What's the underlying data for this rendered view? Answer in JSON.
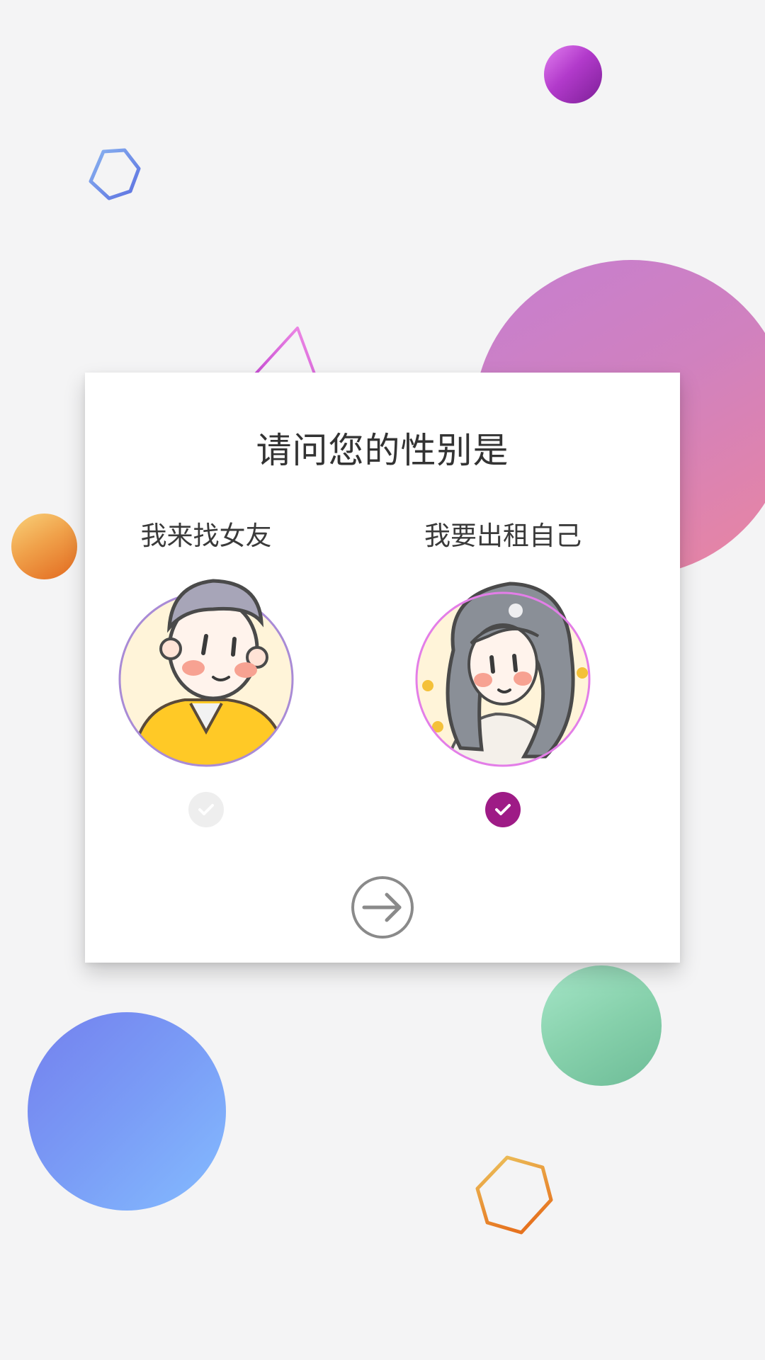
{
  "title": "请问您的性别是",
  "options": [
    {
      "id": "male",
      "label": "我来找女友",
      "selected": false
    },
    {
      "id": "female",
      "label": "我要出租自己",
      "selected": true
    }
  ],
  "colors": {
    "background": "#f4f4f5",
    "selected_check": "#9e1b86",
    "unselected_check": "#eeeeee",
    "male_avatar_ring": "#a98bd6",
    "female_avatar_ring": "#e37ee8",
    "next_button": "#8a8a8a"
  },
  "icons": {
    "next": "arrow-right-circle-icon",
    "check": "checkmark-icon"
  }
}
